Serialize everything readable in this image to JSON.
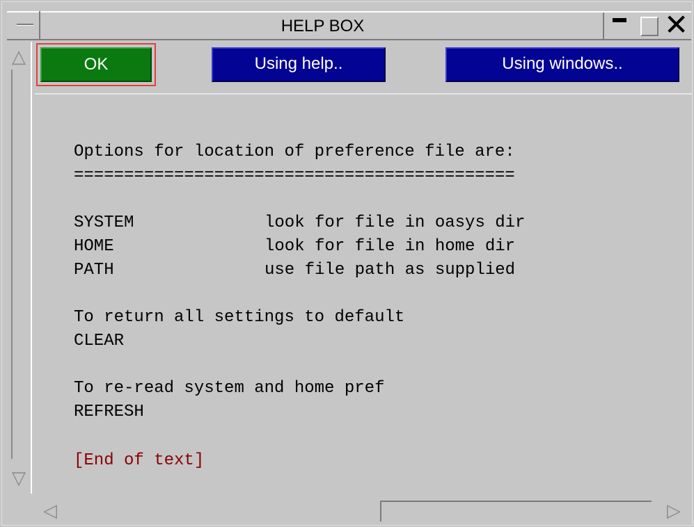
{
  "window": {
    "title": "HELP BOX"
  },
  "toolbar": {
    "ok_label": "OK",
    "using_help_label": "Using help..",
    "using_windows_label": "Using windows.."
  },
  "help_text": {
    "heading": "Options for location of preference file are:",
    "underline": "============================================",
    "options": [
      {
        "key": "SYSTEM",
        "desc": "look for file in oasys dir"
      },
      {
        "key": "HOME",
        "desc": "look for file in home dir"
      },
      {
        "key": "PATH",
        "desc": "use file path as supplied"
      }
    ],
    "reset_line": "To return all settings to default",
    "reset_cmd": "CLEAR",
    "reread_line": "To re-read system and home pref",
    "reread_cmd": "REFRESH",
    "end_marker": "[End of text]"
  },
  "colors": {
    "ok_button": "#0a7a10",
    "ok_focus_border": "#e24040",
    "nav_buttons": "#040494",
    "end_marker": "#8a0000",
    "background": "#c6c6c6"
  },
  "icons": {
    "system_menu": "dash-icon",
    "minimize": "minimize-icon",
    "maximize": "maximize-icon",
    "close": "close-icon",
    "scroll_up": "triangle-up-icon",
    "scroll_down": "triangle-down-icon",
    "scroll_left": "triangle-left-icon",
    "scroll_right": "triangle-right-icon"
  }
}
